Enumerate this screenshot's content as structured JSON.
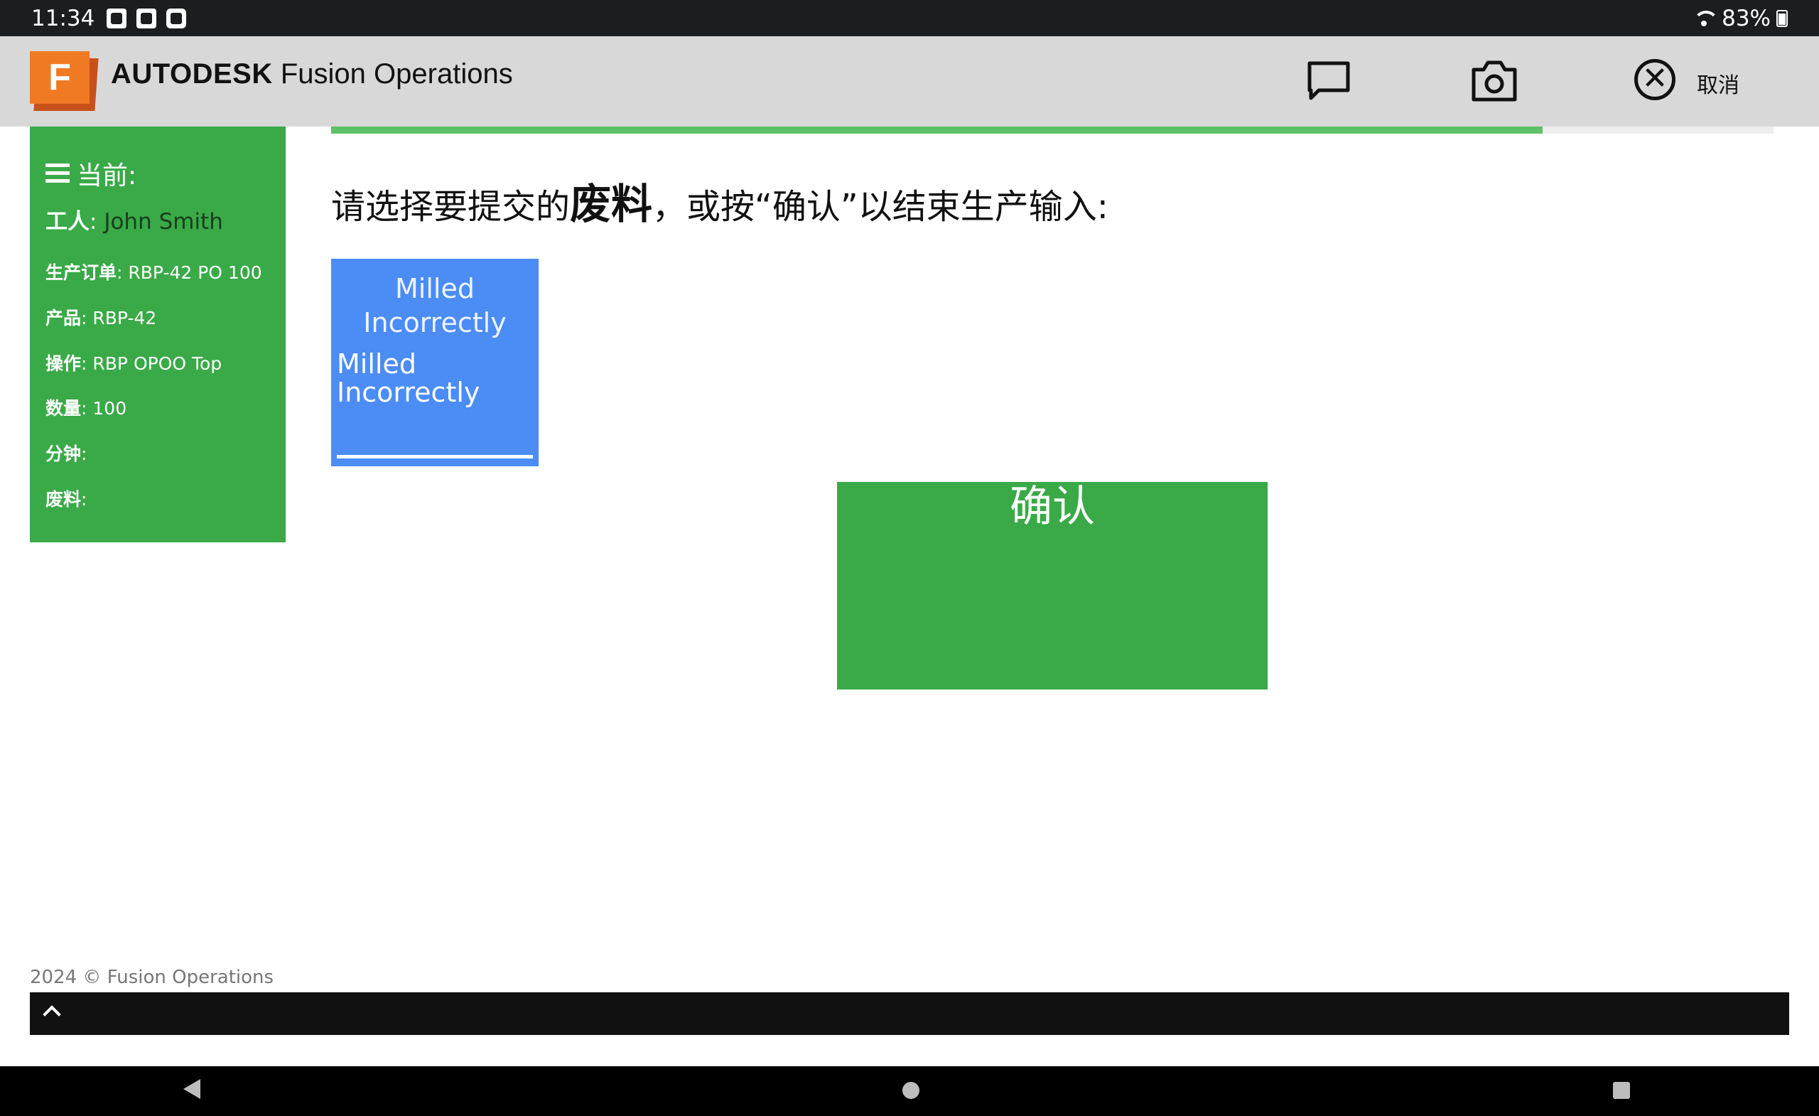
{
  "status_bar": {
    "time": "11:34",
    "notification_icons": [
      "image-icon",
      "photo-icon",
      "clock-icon"
    ],
    "battery": "83%"
  },
  "header": {
    "brand_bold": "AUTODESK",
    "brand_name": "Fusion Operations",
    "logo_letter": "F",
    "cancel_label": "取消",
    "cancel_symbol": "✕"
  },
  "sidebar": {
    "title": "当前:",
    "worker": {
      "key": "工人",
      "value": "John Smith"
    },
    "rows": [
      {
        "key": "生产订单",
        "value": "RBP-42 PO 100"
      },
      {
        "key": "产品",
        "value": "RBP-42"
      },
      {
        "key": "操作",
        "value": "RBP OPOO Top"
      },
      {
        "key": "数量",
        "value": "100"
      },
      {
        "key": "分钟",
        "value": ""
      },
      {
        "key": "废料",
        "value": ""
      }
    ],
    "colon": ":"
  },
  "main": {
    "progress_fraction": 0.84,
    "prompt_pre": "请选择要提交的",
    "prompt_bold": "废料",
    "prompt_post": "，或按“确认”以结束生产输入:",
    "scrap_reasons": [
      {
        "title": "Milled Incorrectly",
        "label": "Milled Incorrectly"
      }
    ],
    "confirm_label": "确认"
  },
  "footer": {
    "copyright": "2024 © Fusion Operations"
  },
  "colors": {
    "sidebar_green": "#39aa47",
    "tile_blue": "#4b8cf5",
    "header_gray": "#d8d8d8",
    "brand_orange": "#f07a24"
  }
}
